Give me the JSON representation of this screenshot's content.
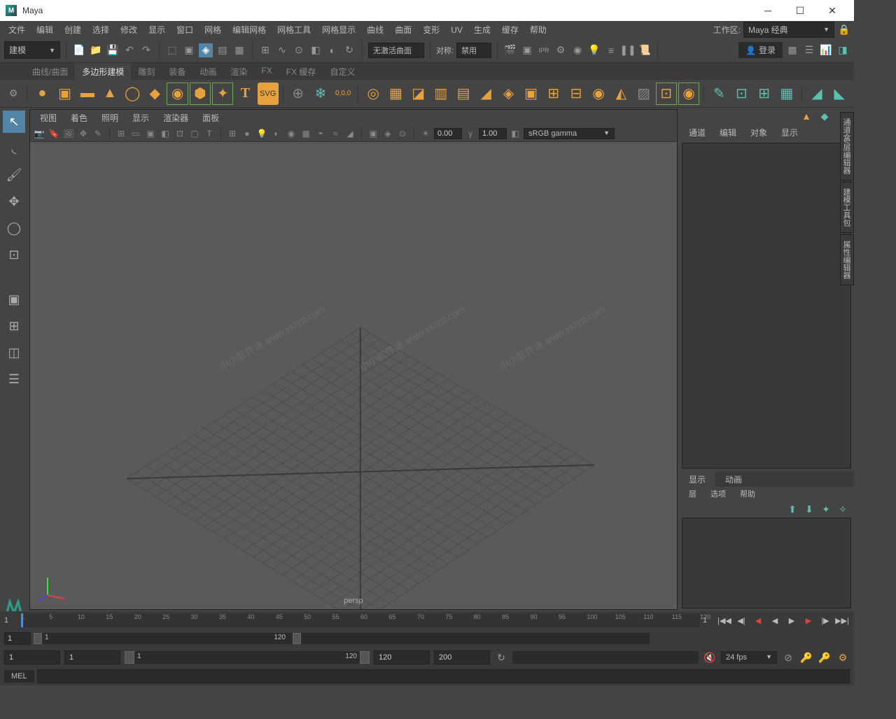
{
  "title": "Maya",
  "menus": [
    "文件",
    "编辑",
    "创建",
    "选择",
    "修改",
    "显示",
    "窗口",
    "网格",
    "编辑网格",
    "网格工具",
    "网格显示",
    "曲线",
    "曲面",
    "变形",
    "UV",
    "生成",
    "缓存",
    "帮助"
  ],
  "workspace": {
    "label": "工作区:",
    "value": "Maya 经典"
  },
  "shelf_dropdown": "建模",
  "status_text": "无激活曲面",
  "symmetry": {
    "label": "对称:",
    "value": "禁用"
  },
  "login_label": "登录",
  "shelf_tabs": [
    "曲线/曲面",
    "多边形建模",
    "雕刻",
    "装备",
    "动画",
    "渲染",
    "FX",
    "FX 缓存",
    "自定义"
  ],
  "shelf_active_tab": 1,
  "viewport_menus": [
    "视图",
    "着色",
    "照明",
    "显示",
    "渲染器",
    "面板"
  ],
  "vp_val1": "0.00",
  "vp_val2": "1.00",
  "color_space": "sRGB gamma",
  "camera_name": "persp",
  "channel_tabs": [
    "通道",
    "编辑",
    "对象",
    "显示"
  ],
  "layer_tabs": [
    "显示",
    "动画"
  ],
  "layer_menu": [
    "层",
    "选项",
    "帮助"
  ],
  "side_tabs": [
    "通道盒/层编辑器",
    "建模工具包",
    "属性编辑器"
  ],
  "timeline": {
    "start": 1,
    "ticks": [
      1,
      5,
      10,
      15,
      20,
      25,
      30,
      35,
      40,
      45,
      50,
      55,
      60,
      65,
      70,
      75,
      80,
      85,
      90,
      95,
      100,
      105,
      110,
      115,
      120
    ]
  },
  "range": {
    "outer_start": "1",
    "inner_start": "1",
    "inner_end": "120",
    "outer_end": "120"
  },
  "bottom": {
    "f1": "1",
    "f2": "1",
    "f3": "120",
    "f4": "200"
  },
  "fps": "24 fps",
  "cmd_lang": "MEL",
  "watermark": "小小软件迷 www.xxrjm.com"
}
